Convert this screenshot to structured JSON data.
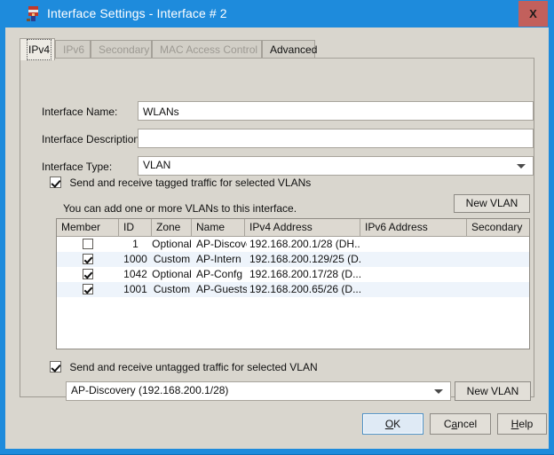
{
  "window": {
    "title": "Interface Settings - Interface # 2",
    "icon": "firewall-appliance-icon",
    "close_label": "X",
    "frame_color": "#1e8bdc",
    "close_color": "#c2605c"
  },
  "tabs": [
    {
      "label": "IPv4",
      "state": "active"
    },
    {
      "label": "IPv6",
      "state": "disabled"
    },
    {
      "label": "Secondary",
      "state": "disabled"
    },
    {
      "label": "MAC Access Control",
      "state": "disabled"
    },
    {
      "label": "Advanced",
      "state": "enabled"
    }
  ],
  "form": {
    "interface_name_label": "Interface Name:",
    "interface_name_value": "WLANs",
    "interface_description_label": "Interface Description:",
    "interface_description_value": "",
    "interface_description_placeholder": "",
    "interface_type_label": "Interface Type:",
    "interface_type_value": "VLAN",
    "tagged_checkbox_label": "Send and receive tagged traffic for selected VLANs",
    "tagged_checkbox_checked": true,
    "vlan_hint": "You can add one or more VLANs to this interface.",
    "new_vlan_button": "New VLAN",
    "untagged_checkbox_label": "Send and receive untagged traffic for selected VLAN",
    "untagged_checkbox_checked": true,
    "untagged_vlan_value": "AP-Discovery (192.168.200.1/28)",
    "new_vlan_button_2": "New VLAN"
  },
  "grid": {
    "columns": [
      {
        "label": "Member"
      },
      {
        "label": "ID"
      },
      {
        "label": "Zone"
      },
      {
        "label": "Name"
      },
      {
        "label": "IPv4 Address"
      },
      {
        "label": "IPv6 Address"
      },
      {
        "label": "Secondary"
      }
    ],
    "rows": [
      {
        "member": false,
        "id": "1",
        "zone": "Optional",
        "name": "AP-Discovery",
        "ipv4": "192.168.200.1/28 (DH...",
        "ipv6": "",
        "secondary": ""
      },
      {
        "member": true,
        "id": "1000",
        "zone": "Custom",
        "name": "AP-Intern",
        "ipv4": "192.168.200.129/25 (D...",
        "ipv6": "",
        "secondary": ""
      },
      {
        "member": true,
        "id": "1042",
        "zone": "Optional",
        "name": "AP-Confg",
        "ipv4": "192.168.200.17/28 (D...",
        "ipv6": "",
        "secondary": ""
      },
      {
        "member": true,
        "id": "1001",
        "zone": "Custom",
        "name": "AP-Guests",
        "ipv4": "192.168.200.65/26 (D...",
        "ipv6": "",
        "secondary": ""
      }
    ]
  },
  "footer": {
    "ok_pre": "O",
    "ok_accel": "K",
    "ok_post": "",
    "cancel_pre": "C",
    "cancel_accel": "a",
    "cancel_post": "ncel",
    "help_pre": "",
    "help_accel": "H",
    "help_post": "elp"
  }
}
